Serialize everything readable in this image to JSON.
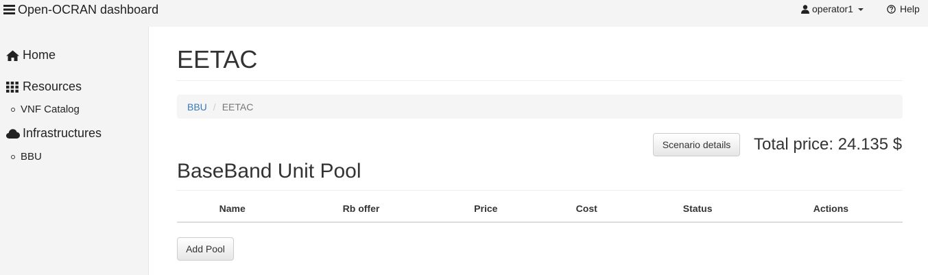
{
  "navbar": {
    "brand_title": "Open-OCRAN dashboard",
    "brand_icon": "hamburger-icon",
    "user_label": "operator1",
    "user_icon": "user-icon",
    "help_label": "Help",
    "help_icon": "question-circle-icon"
  },
  "sidebar": {
    "home": {
      "label": "Home",
      "icon": "home-icon"
    },
    "resources": {
      "label": "Resources",
      "icon": "grid-icon"
    },
    "vnf_catalog": {
      "label": "VNF Catalog"
    },
    "infrastructures": {
      "label": "Infrastructures",
      "icon": "cloud-icon"
    },
    "bbu": {
      "label": "BBU"
    }
  },
  "main": {
    "title": "EETAC",
    "breadcrumb": {
      "items": [
        {
          "label": "BBU",
          "link": true
        },
        {
          "label": "EETAC",
          "link": false
        }
      ],
      "separator": "/"
    },
    "scenario_button": "Scenario details",
    "total_price": "Total price: 24.135 $",
    "pool_title": "BaseBand Unit Pool",
    "table": {
      "headers": [
        "Name",
        "Rb offer",
        "Price",
        "Cost",
        "Status",
        "Actions"
      ],
      "rows": []
    },
    "add_pool_button": "Add Pool"
  },
  "colors": {
    "link": "#337ab7",
    "navbar_bg": "#f4f4f4",
    "breadcrumb_bg": "#f5f5f5",
    "text": "#333333"
  }
}
